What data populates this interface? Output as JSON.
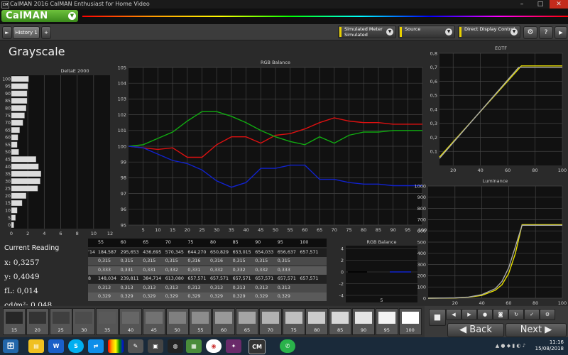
{
  "window": {
    "title": "CalMAN 2016 CalMAN Enthusiast for Home Video",
    "app_icon": "CM",
    "minimize": "–",
    "maximize": "□",
    "close": "✕"
  },
  "brand": {
    "logo": "CalMAN"
  },
  "toolbar": {
    "nav_arrow": "►",
    "tab_label": "History 1",
    "add_tab": "+",
    "meter_label_1": "Simulated Meter",
    "meter_label_2": "Simulated",
    "source_label": "Source",
    "display_label": "Direct Display Control",
    "gear": "⚙",
    "help": "?",
    "more": "▶"
  },
  "page": {
    "title": "Grayscale"
  },
  "charts": {
    "deltae": {
      "title": "DeltaE 2000",
      "type": "bar",
      "categories": [
        "100",
        "95",
        "90",
        "85",
        "80",
        "75",
        "70",
        "65",
        "60",
        "55",
        "50",
        "45",
        "40",
        "35",
        "30",
        "25",
        "20",
        "15",
        "10",
        "5",
        "0"
      ],
      "values": [
        2.1,
        2.0,
        1.9,
        1.9,
        1.8,
        1.6,
        1.4,
        1.0,
        0.8,
        0.7,
        0.9,
        3.0,
        3.3,
        3.6,
        3.5,
        3.2,
        1.8,
        1.3,
        0.7,
        0.5,
        0.3
      ],
      "xticks": [
        "0",
        "2",
        "4",
        "6",
        "8",
        "10",
        "12"
      ],
      "xlim": [
        0,
        12
      ]
    },
    "rgb_balance": {
      "title": "RGB Balance",
      "type": "line",
      "x": [
        0,
        5,
        10,
        15,
        20,
        25,
        30,
        35,
        40,
        45,
        50,
        55,
        60,
        65,
        70,
        75,
        80,
        85,
        90,
        95,
        100
      ],
      "series": [
        {
          "color": "#dd1111",
          "values": [
            100,
            99.9,
            99.8,
            99.9,
            99.3,
            99.3,
            100.1,
            100.6,
            100.6,
            100.2,
            100.7,
            100.8,
            101.1,
            101.5,
            101.8,
            101.6,
            101.5,
            101.5,
            101.4,
            101.4,
            101.4
          ]
        },
        {
          "color": "#11aa11",
          "values": [
            100,
            100.1,
            100.5,
            100.9,
            101.6,
            102.2,
            102.2,
            101.9,
            101.5,
            101.0,
            100.6,
            100.3,
            100.1,
            100.6,
            100.2,
            100.7,
            100.9,
            100.9,
            101.0,
            101.0,
            101.0
          ]
        },
        {
          "color": "#1122cc",
          "values": [
            100,
            99.9,
            99.5,
            99.1,
            98.9,
            98.5,
            97.8,
            97.4,
            97.7,
            98.6,
            98.6,
            98.8,
            98.8,
            97.9,
            97.9,
            97.7,
            97.6,
            97.6,
            97.5,
            97.5,
            97.5
          ]
        }
      ],
      "xticks": [
        "5",
        "10",
        "15",
        "20",
        "25",
        "30",
        "35",
        "40",
        "45",
        "50",
        "55",
        "60",
        "65",
        "70",
        "75",
        "80",
        "85",
        "90",
        "95",
        "100"
      ],
      "yticks": [
        "105",
        "104",
        "103",
        "102",
        "101",
        "100",
        "99",
        "98",
        "97",
        "96",
        "95"
      ],
      "ylim": [
        95,
        105
      ],
      "xlim": [
        0,
        100
      ]
    },
    "eotf": {
      "title": "EOTF",
      "type": "line",
      "xticks": [
        "20",
        "40",
        "60",
        "80",
        "100"
      ],
      "yticks": [
        "0,8",
        "0,7",
        "0,6",
        "0,5",
        "0,4",
        "0,3",
        "0,2",
        "0,1"
      ],
      "ylim": [
        0,
        0.8
      ],
      "xlim": [
        10,
        100
      ],
      "series": [
        {
          "color": "#e8e000",
          "x": [
            10,
            70,
            100
          ],
          "values": [
            0.06,
            0.71,
            0.71
          ]
        },
        {
          "color": "#aaaaaa",
          "x": [
            10,
            68,
            100
          ],
          "values": [
            0.05,
            0.7,
            0.7
          ]
        }
      ]
    },
    "luminance": {
      "title": "Luminance",
      "type": "line",
      "xticks": [
        "20",
        "40",
        "60",
        "80",
        "100"
      ],
      "yticks": [
        "1000",
        "900",
        "800",
        "700",
        "600",
        "500",
        "400",
        "300",
        "200",
        "100",
        "0"
      ],
      "ylim": [
        0,
        1000
      ],
      "xlim": [
        0,
        100
      ],
      "series": [
        {
          "color": "#e8e000",
          "x": [
            0,
            20,
            30,
            40,
            50,
            55,
            60,
            65,
            70,
            100
          ],
          "values": [
            0,
            2,
            8,
            25,
            70,
            120,
            220,
            400,
            655,
            655
          ]
        },
        {
          "color": "#aaaaaa",
          "x": [
            0,
            20,
            30,
            40,
            50,
            55,
            60,
            65,
            70,
            100
          ],
          "values": [
            0,
            3,
            10,
            32,
            85,
            150,
            270,
            460,
            650,
            650
          ]
        }
      ]
    },
    "rgb_mini": {
      "title": "RGB Balance",
      "yticks": [
        "4",
        "2",
        "0",
        "-2",
        "-4"
      ],
      "xtick": "5"
    }
  },
  "reading": {
    "title": "Current Reading",
    "x": "x: 0,3257",
    "y": "y: 0,4049",
    "fl": "fL: 0,014",
    "cdm2": "cd/m²: 0,048"
  },
  "table": {
    "headers": [
      "55",
      "60",
      "65",
      "70",
      "75",
      "80",
      "85",
      "90",
      "95",
      "100"
    ],
    "rows": [
      [
        "’14",
        "184,587",
        "295,653",
        "436,695",
        "570,345",
        "644,270",
        "650,829",
        "653,015",
        "654,033",
        "656,637",
        "657,571"
      ],
      [
        "",
        "0,315",
        "0,315",
        "0,315",
        "0,315",
        "0,316",
        "0,316",
        "0,315",
        "0,315",
        "0,315",
        ""
      ],
      [
        "",
        "0,333",
        "0,331",
        "0,331",
        "0,332",
        "0,331",
        "0,332",
        "0,332",
        "0,332",
        "0,333",
        ""
      ],
      [
        "8",
        "148,034",
        "239,811",
        "384,714",
        "613,080",
        "657,571",
        "657,571",
        "657,571",
        "657,571",
        "657,571",
        "657,571"
      ],
      [
        "",
        "0,313",
        "0,313",
        "0,313",
        "0,313",
        "0,313",
        "0,313",
        "0,313",
        "0,313",
        "0,313",
        ""
      ],
      [
        "",
        "0,329",
        "0,329",
        "0,329",
        "0,329",
        "0,329",
        "0,329",
        "0,329",
        "0,329",
        "0,329",
        ""
      ]
    ]
  },
  "swatches": [
    {
      "label": "15",
      "color": "#262626"
    },
    {
      "label": "20",
      "color": "#333333"
    },
    {
      "label": "25",
      "color": "#3f3f3f"
    },
    {
      "label": "30",
      "color": "#4c4c4c"
    },
    {
      "label": "35",
      "color": "#595959"
    },
    {
      "label": "40",
      "color": "#666666"
    },
    {
      "label": "45",
      "color": "#727272"
    },
    {
      "label": "50",
      "color": "#7f7f7f"
    },
    {
      "label": "55",
      "color": "#8c8c8c"
    },
    {
      "label": "60",
      "color": "#999999"
    },
    {
      "label": "65",
      "color": "#a5a5a5"
    },
    {
      "label": "70",
      "color": "#b2b2b2"
    },
    {
      "label": "75",
      "color": "#bfbfbf"
    },
    {
      "label": "80",
      "color": "#cccccc"
    },
    {
      "label": "85",
      "color": "#d8d8d8"
    },
    {
      "label": "90",
      "color": "#e5e5e5"
    },
    {
      "label": "95",
      "color": "#f2f2f2"
    },
    {
      "label": "100",
      "color": "#ffffff"
    }
  ],
  "nav": {
    "back": "Back",
    "next": "Next",
    "back_arrow": "◀",
    "next_arrow": "▶",
    "stop": "■",
    "play": "▶",
    "record": "●"
  },
  "taskbar": {
    "time": "11:16",
    "date": "15/08/2018",
    "start": "⊞"
  }
}
